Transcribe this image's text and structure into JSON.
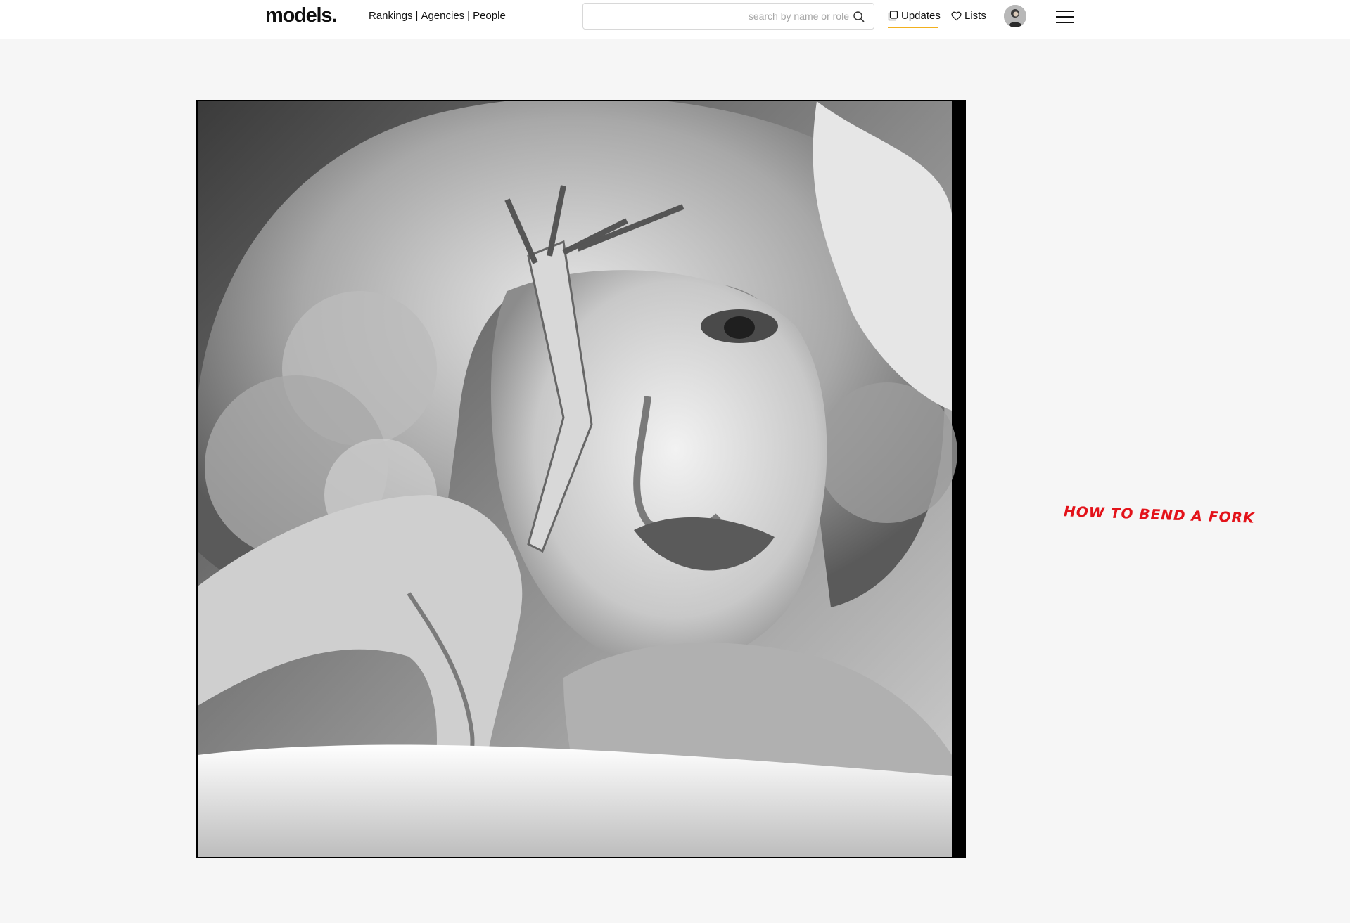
{
  "header": {
    "logo": "models.",
    "nav": [
      {
        "label": "Rankings"
      },
      {
        "label": "Agencies"
      },
      {
        "label": "People"
      }
    ],
    "nav_separator": "|",
    "search": {
      "placeholder": "search by name or role",
      "value": "",
      "icon": "search-icon"
    },
    "updates_label": "Updates",
    "lists_label": "Lists",
    "accent_color": "#f2b01e"
  },
  "main": {
    "photo_alt": "Black and white portrait of a model holding a bent fork to her eye",
    "caption": "HOW TO BEND A FORK",
    "caption_color": "#e3131a"
  }
}
